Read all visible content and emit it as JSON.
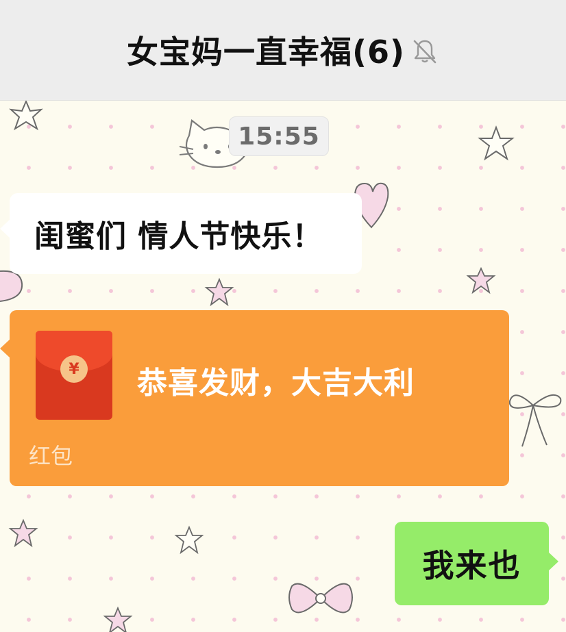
{
  "header": {
    "title": "女宝妈一直幸福(6)",
    "mute_icon": "bell-muted-icon"
  },
  "chat": {
    "timestamp": "15:55",
    "messages": [
      {
        "type": "text",
        "side": "left",
        "text": "闺蜜们 情人节快乐！"
      },
      {
        "type": "red-packet",
        "side": "left",
        "icon": "red-envelope-icon",
        "coin_symbol": "¥",
        "title": "恭喜发财，大吉大利",
        "footer": "红包"
      },
      {
        "type": "text",
        "side": "right",
        "text": "我来也"
      }
    ]
  },
  "colors": {
    "header_bg": "#ededed",
    "chat_bg": "#fdfbef",
    "red_packet": "#fa9d3b",
    "self_bubble": "#95ec69",
    "other_bubble": "#ffffff"
  }
}
